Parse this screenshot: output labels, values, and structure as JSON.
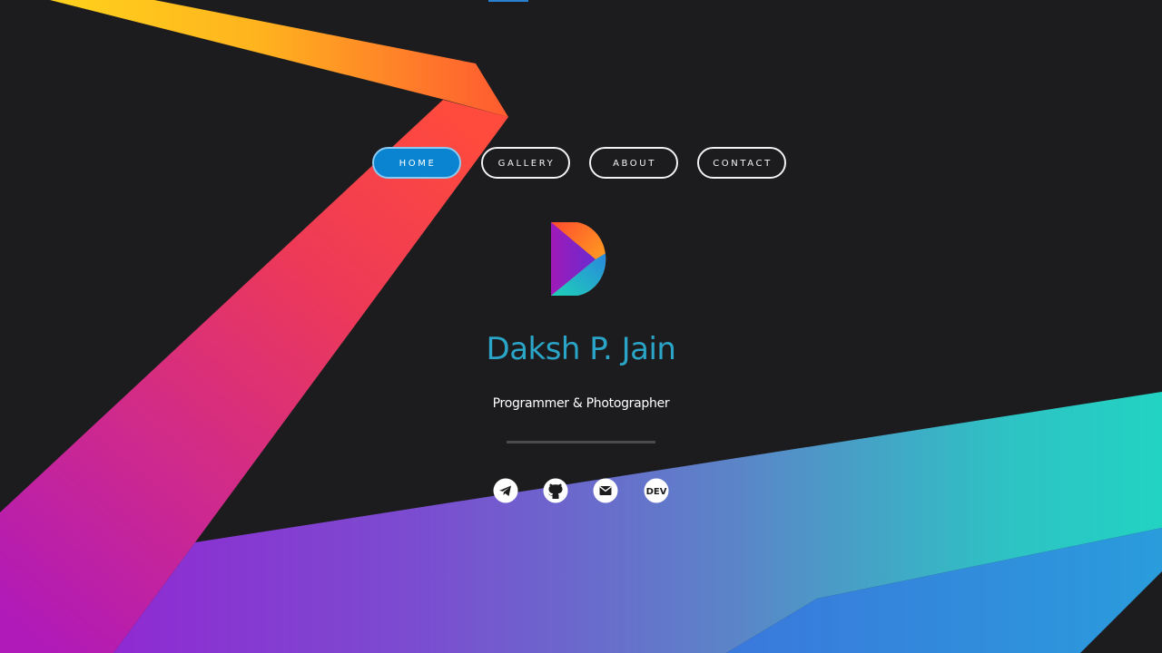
{
  "nav": {
    "items": [
      {
        "label": "HOME",
        "active": true
      },
      {
        "label": "GALLERY",
        "active": false
      },
      {
        "label": "ABOUT",
        "active": false
      },
      {
        "label": "CONTACT",
        "active": false
      }
    ]
  },
  "hero": {
    "logo_icon": "d-logo-icon",
    "name": "Daksh P. Jain",
    "tagline": "Programmer & Photographer"
  },
  "social": [
    {
      "icon": "telegram-icon"
    },
    {
      "icon": "github-icon"
    },
    {
      "icon": "email-icon"
    },
    {
      "icon": "dev-icon",
      "text": "DEV"
    }
  ],
  "colors": {
    "background": "#1c1c1e",
    "accent_blue": "#0a84d0",
    "name_color": "#2aa5c8",
    "ribbon_yellow": "#ffc21a",
    "ribbon_orange": "#ff7a2e",
    "ribbon_red": "#f5364c",
    "ribbon_magenta": "#c21cb0",
    "ribbon_purple": "#9a2ad6",
    "ribbon_teal": "#22d3c2",
    "ribbon_blue": "#2a8cdc"
  }
}
